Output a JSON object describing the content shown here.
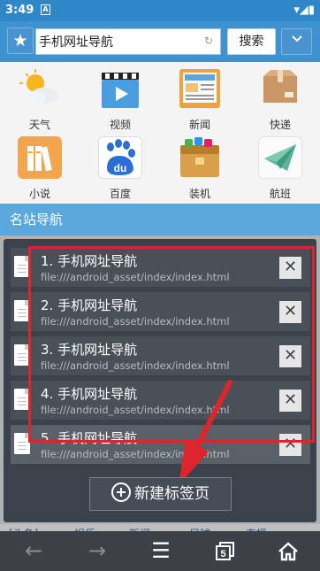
{
  "status": {
    "time": "3:49",
    "notif_letter": "A",
    "right_icons": "▾◢▮"
  },
  "search": {
    "fav_icon": "★",
    "value": "手机网址导航",
    "refresh_icon": "↻",
    "button": "搜索",
    "dropdown_icon": "⌄"
  },
  "apps": [
    {
      "label": "天气",
      "icon": "weather-icon"
    },
    {
      "label": "视频",
      "icon": "video-icon"
    },
    {
      "label": "新闻",
      "icon": "news-icon"
    },
    {
      "label": "快递",
      "icon": "package-icon"
    },
    {
      "label": "小说",
      "icon": "books-icon"
    },
    {
      "label": "百度",
      "icon": "baidu-icon",
      "text": "du"
    },
    {
      "label": "装机",
      "icon": "apps-box-icon"
    },
    {
      "label": "航班",
      "icon": "paper-plane-icon"
    }
  ],
  "section_title": "名站导航",
  "behind_links": [
    "[头条]",
    "娱乐",
    "新闻",
    "足球",
    "直播"
  ],
  "tabs": [
    {
      "title": "1. 手机网址导航",
      "url": "file:///android_asset/index/index.html",
      "close": "✕"
    },
    {
      "title": "2. 手机网址导航",
      "url": "file:///android_asset/index/index.html",
      "close": "✕"
    },
    {
      "title": "3. 手机网址导航",
      "url": "file:///android_asset/index/index.html",
      "close": "✕"
    },
    {
      "title": "4. 手机网址导航",
      "url": "file:///android_asset/index/index.html",
      "close": "✕"
    },
    {
      "title": "5. 手机网址导航",
      "url": "file:///android_asset/index/index.html",
      "close": "✕"
    }
  ],
  "new_tab_label": "新建标签页",
  "bottom_nav": {
    "back": "←",
    "forward": "→",
    "menu": "☰",
    "tab_count": "5",
    "home": "⌂"
  },
  "colors": {
    "accent": "#3d92cf",
    "highlight": "#e0242c"
  }
}
